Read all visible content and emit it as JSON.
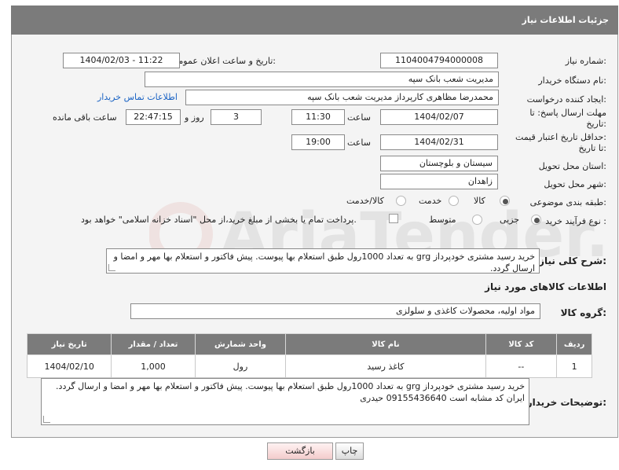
{
  "page": {
    "title": "جزئیات اطلاعات نیاز"
  },
  "fields": {
    "need_number": {
      "label": "شماره نیاز:",
      "value": "1104004794000008"
    },
    "announce_datetime": {
      "label": "تاریخ و ساعت اعلان عمومی:",
      "value": "1404/02/03 - 11:22"
    },
    "buyer_org": {
      "label": "نام دستگاه خریدار:",
      "value": "مدیریت شعب بانک سپه"
    },
    "requester": {
      "label": "ایجاد کننده درخواست:",
      "value": "محمدرضا مظاهری کارپرداز مدیریت شعب بانک سپه"
    },
    "contact_link": "اطلاعات تماس خریدار",
    "reply_deadline": {
      "label_line1": "مهلت ارسال پاسخ: تا",
      "label_line2": "تاریخ:",
      "date": "1404/02/07",
      "time_label": "ساعت",
      "time": "11:30",
      "days": "3",
      "days_label": "روز و",
      "remaining": "22:47:15",
      "remaining_label": "ساعت باقی مانده"
    },
    "price_validity": {
      "label_line1": "حداقل تاریخ اعتبار قیمت:",
      "label_line2": "تا تاریخ:",
      "date": "1404/02/31",
      "time_label": "ساعت",
      "time": "19:00"
    },
    "delivery_province": {
      "label": "استان محل تحویل:",
      "value": "سیستان و بلوچستان"
    },
    "delivery_city": {
      "label": "شهر محل تحویل:",
      "value": "زاهدان"
    },
    "category": {
      "label": "طبقه بندی موضوعی:",
      "options": [
        "کالا",
        "خدمت",
        "کالا/خدمت"
      ],
      "selected": "کالا"
    },
    "purchase_process": {
      "label": "نوع فرآیند خرید :",
      "options": [
        "جزیی",
        "متوسط"
      ],
      "selected": "جزیی",
      "payment_note": "پرداخت تمام یا بخشی از مبلغ خرید،از محل \"اسناد خزانه اسلامی\" خواهد بود."
    }
  },
  "description": {
    "label": "شرح کلی نیاز:",
    "text": "خرید رسید مشتری خودپرداز grg به تعداد 1000رول طبق استعلام بها پیوست. پیش فاکتور و استعلام بها مهر و امضا و ارسال گردد."
  },
  "goods_section": {
    "title": "اطلاعات کالاهای مورد نیاز",
    "group_label": "گروه کالا:",
    "group_value": "مواد اولیه، محصولات کاغذی و سلولزی"
  },
  "table": {
    "headers": [
      "ردیف",
      "کد کالا",
      "نام کالا",
      "واحد شمارش",
      "تعداد / مقدار",
      "تاریخ نیاز"
    ],
    "rows": [
      [
        "1",
        "--",
        "کاغذ رسید",
        "رول",
        "1,000",
        "1404/02/10"
      ]
    ]
  },
  "buyer_notes": {
    "label": "توضیحات خریدار:",
    "text": "خرید رسید مشتری خودپرداز grg به تعداد 1000رول طبق استعلام بها پیوست. پیش فاکتور و استعلام بها مهر و امضا و ارسال گردد. ایران کد مشابه است 09155436640 حیدری"
  },
  "buttons": {
    "print": "چاپ",
    "back": "بازگشت"
  },
  "watermark": "AriaTender.neT",
  "colors": {
    "header": "#7b7b7b",
    "link": "#1a63c4",
    "panel": "#f4f4f4"
  }
}
